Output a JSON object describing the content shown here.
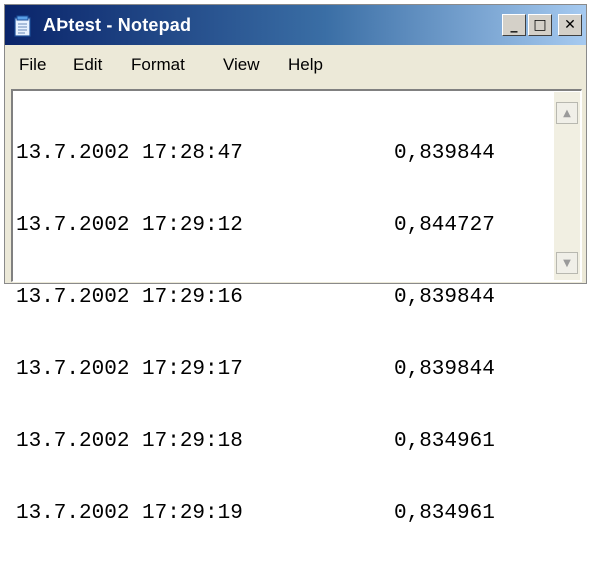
{
  "window": {
    "title": "AÞtest - Notepad",
    "icon": "notepad-icon",
    "controls": {
      "minimize": "_",
      "maximize": "□",
      "close": "✕"
    }
  },
  "menu": {
    "items": [
      {
        "label": "File"
      },
      {
        "label": "Edit"
      },
      {
        "label": "Format"
      },
      {
        "label": "View"
      },
      {
        "label": "Help"
      }
    ]
  },
  "content": {
    "lines": [
      {
        "datetime": "13.7.2002 17:28:47",
        "value": "0,839844"
      },
      {
        "datetime": "13.7.2002 17:29:12",
        "value": "0,844727"
      },
      {
        "datetime": "13.7.2002 17:29:16",
        "value": "0,839844"
      },
      {
        "datetime": "13.7.2002 17:29:17",
        "value": "0,839844"
      },
      {
        "datetime": "13.7.2002 17:29:18",
        "value": "0,834961"
      },
      {
        "datetime": "13.7.2002 17:29:19",
        "value": "0,834961"
      }
    ]
  },
  "scrollbar": {
    "up_glyph": "▲",
    "down_glyph": "▼"
  },
  "colors": {
    "titlebar_start": "#0a246a",
    "titlebar_end": "#a6caf0",
    "window_face": "#ece9d8"
  }
}
